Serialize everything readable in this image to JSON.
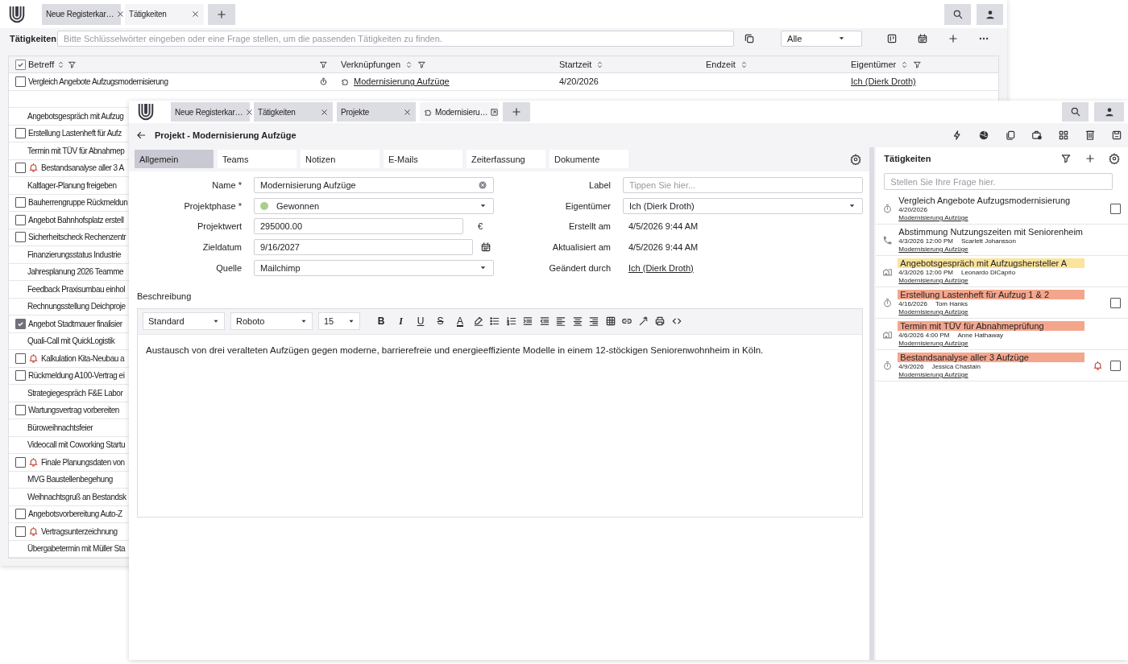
{
  "back_window": {
    "tabs": [
      {
        "label": "Neue Registerkar…",
        "selected": false
      },
      {
        "label": "Tätigkeiten",
        "selected": true
      }
    ],
    "toolbar": {
      "title": "Tätigkeiten",
      "placeholder": "Bitte Schlüsselwörter eingeben oder eine Frage stellen, um die passenden Tätigkeiten zu finden.",
      "filter": "Alle"
    },
    "table": {
      "columns": [
        "Betreff",
        "Verknüpfungen",
        "Startzeit",
        "Endzeit",
        "Eigentümer"
      ],
      "header_checked": true,
      "rows": [
        {
          "checked": false,
          "alarm": false,
          "subject": "Vergleich Angebote Aufzugsmodernisierung",
          "kind": "timer",
          "link": "Modernisierung Aufzüge",
          "start": "4/20/2026",
          "owner": "Ich (Dierk Droth)"
        },
        {
          "alarm": false
        },
        {
          "alarm": false,
          "subject": "Angebotsgespräch mit Aufzug"
        },
        {
          "checked": false,
          "alarm": false,
          "subject": "Erstellung Lastenheft für Aufz"
        },
        {
          "alarm": false,
          "subject": "Termin mit TÜV für Abnahmep"
        },
        {
          "checked": false,
          "alarm": true,
          "subject": "Bestandsanalyse aller 3 A"
        },
        {
          "alarm": false,
          "subject": "Kaltlager-Planung freigeben"
        },
        {
          "checked": false,
          "alarm": false,
          "subject": "Bauherrengruppe Rückmeldun"
        },
        {
          "checked": false,
          "alarm": false,
          "subject": "Angebot Bahnhofsplatz erstell"
        },
        {
          "checked": false,
          "alarm": false,
          "subject": "Sicherheitscheck Rechenzentr"
        },
        {
          "alarm": false,
          "subject": "Finanzierungsstatus Industrie"
        },
        {
          "alarm": false,
          "subject": "Jahresplanung 2026 Teamme"
        },
        {
          "alarm": false,
          "subject": "Feedback Praxisumbau einhol"
        },
        {
          "alarm": false,
          "subject": "Rechnungsstellung Deichproje"
        },
        {
          "checked": true,
          "alarm": false,
          "subject": "Angebot Stadtmauer finalisier"
        },
        {
          "alarm": false,
          "subject": "Quali-Call mit QuickLogistik"
        },
        {
          "checked": false,
          "alarm": true,
          "subject": "Kalkulation Kita-Neubau a"
        },
        {
          "checked": false,
          "alarm": false,
          "subject": "Rückmeldung A100-Vertrag ei"
        },
        {
          "alarm": false,
          "subject": "Strategiegespräch F&E Labor"
        },
        {
          "checked": false,
          "alarm": false,
          "subject": "Wartungsvertrag vorbereiten"
        },
        {
          "alarm": false,
          "subject": "Büroweihnachtsfeier"
        },
        {
          "alarm": false,
          "subject": "Videocall mit Coworking Startu"
        },
        {
          "checked": false,
          "alarm": true,
          "subject": "Finale Planungsdaten von"
        },
        {
          "alarm": false,
          "subject": "MVG Baustellenbegehung"
        },
        {
          "alarm": false,
          "subject": "Weihnachtsgruß an Bestandsk"
        },
        {
          "checked": false,
          "alarm": false,
          "subject": "Angebotsvorbereitung Auto-Z"
        },
        {
          "checked": false,
          "alarm": true,
          "subject": "Vertragsunterzeichnung"
        },
        {
          "alarm": false,
          "subject": "Übergabetermin mit Müller Sta"
        }
      ]
    }
  },
  "front_window": {
    "tabs": [
      {
        "kind": "list",
        "label": "Neue Registerkar…",
        "selected": false
      },
      {
        "kind": "list",
        "label": "Tätigkeiten",
        "selected": false
      },
      {
        "kind": "list",
        "label": "Projekte",
        "selected": false
      },
      {
        "kind": "record",
        "label": "Modernisieru…",
        "selected": true
      }
    ],
    "title": "Projekt - Modernisierung Aufzüge",
    "sections": [
      {
        "label": "Allgemein",
        "selected": true
      },
      {
        "label": "Teams",
        "selected": false
      },
      {
        "label": "Notizen",
        "selected": false
      },
      {
        "label": "E-Mails",
        "selected": false
      },
      {
        "label": "Zeiterfassung",
        "selected": false
      },
      {
        "label": "Dokumente",
        "selected": false
      }
    ],
    "form_left": [
      {
        "kind": "clearable",
        "label": "Name *",
        "value": "Modernisierung Aufzüge"
      },
      {
        "kind": "select",
        "label": "Projektphase *",
        "value": "Gewonnen",
        "color": "#a9cf8e"
      },
      {
        "kind": "number",
        "label": "Projektwert",
        "value": "295000.00",
        "unit": "€"
      },
      {
        "kind": "date",
        "label": "Zieldatum",
        "value": "9/16/2027"
      },
      {
        "kind": "select",
        "label": "Quelle",
        "value": "Mailchimp"
      }
    ],
    "form_right": [
      {
        "kind": "input",
        "label": "Label",
        "placeholder": "Tippen Sie hier..."
      },
      {
        "kind": "select",
        "label": "Eigentümer",
        "value": "Ich (Dierk Droth)"
      },
      {
        "kind": "static",
        "label": "Erstellt am",
        "value": "4/5/2026 9:44 AM"
      },
      {
        "kind": "static",
        "label": "Aktualisiert am",
        "value": "4/5/2026 9:44 AM"
      },
      {
        "kind": "link",
        "label": "Geändert durch",
        "value": "Ich (Dierk Droth)"
      }
    ],
    "description": {
      "label": "Beschreibung",
      "style": "Standard",
      "font": "Roboto",
      "size": "15",
      "format_buttons": [
        {
          "kind": "bold",
          "label": "B"
        },
        {
          "kind": "italic",
          "label": "I"
        },
        {
          "kind": "underline",
          "label": "U"
        },
        {
          "kind": "strike",
          "label": "S"
        },
        {
          "kind": "color",
          "label": "A"
        },
        {
          "kind": "highlight"
        },
        {
          "kind": "bullets"
        },
        {
          "kind": "numbers"
        },
        {
          "kind": "indent"
        },
        {
          "kind": "outdent"
        },
        {
          "kind": "align-left"
        },
        {
          "kind": "align-center"
        },
        {
          "kind": "align-right"
        },
        {
          "kind": "table"
        },
        {
          "kind": "link"
        },
        {
          "kind": "magic"
        },
        {
          "kind": "print"
        },
        {
          "kind": "code"
        }
      ],
      "text": "Austausch von drei veralteten Aufzügen gegen moderne, barrierefreie und energieeffiziente Modelle in einem 12-stöckigen Seniorenwohnheim in Köln."
    },
    "activities": {
      "title": "Tätigkeiten",
      "placeholder": "Stellen Sie Ihre Frage hier.",
      "items": [
        {
          "kind": "timer",
          "title": "Vergleich Angebote Aufzugsmodernisierung",
          "date": "4/20/2026",
          "link": "Modernisierung Aufzüge",
          "checked": false,
          "alarm": false
        },
        {
          "kind": "phone",
          "title": "Abstimmung Nutzungszeiten mit Seniorenheim",
          "date": "4/3/2026 12:00 PM",
          "person": "Scarlett Johansson",
          "link": "Modernisierung Aufzüge",
          "alarm": false
        },
        {
          "kind": "building",
          "title": "Angebotsgespräch mit Aufzugshersteller A",
          "color": "#fbe39b",
          "date": "4/3/2026 12:00 PM",
          "person": "Leonardo DiCaprio",
          "link": "Modernisierung Aufzüge",
          "alarm": false
        },
        {
          "kind": "timer",
          "title": "Erstellung Lastenheft für Aufzug 1 & 2",
          "color": "#f4a68d",
          "date": "4/16/2026",
          "person": "Tom Hanks",
          "link": "Modernisierung Aufzüge",
          "checked": false,
          "alarm": false
        },
        {
          "kind": "building",
          "title": "Termin mit TÜV für Abnahmeprüfung",
          "color": "#f4a68d",
          "date": "4/6/2026 4:00 PM",
          "person": "Anne Hathaway",
          "link": "Modernisierung Aufzüge",
          "alarm": false
        },
        {
          "kind": "timer",
          "title": "Bestandsanalyse aller 3 Aufzüge",
          "color": "#f4a68d",
          "date": "4/9/2026",
          "person": "Jessica Chastain",
          "link": "Modernisierung Aufzüge",
          "checked": false,
          "alarm": true
        }
      ]
    }
  }
}
